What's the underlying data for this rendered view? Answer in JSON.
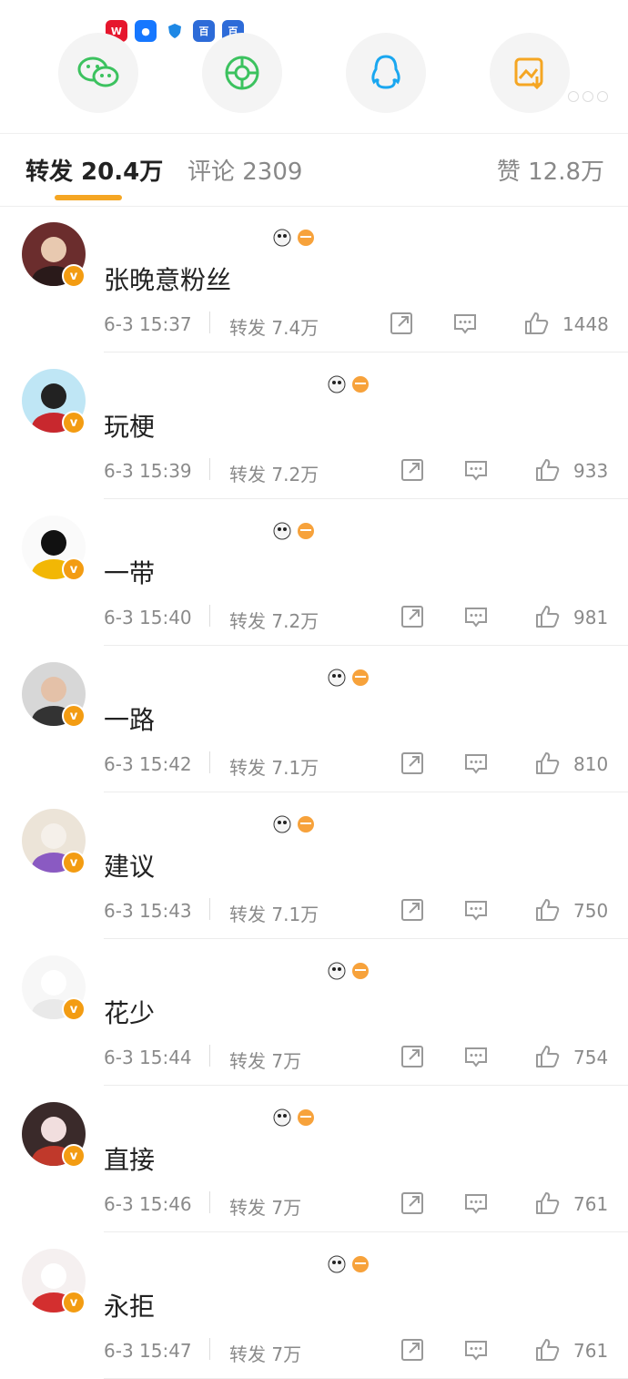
{
  "share_targets": [
    {
      "name": "wechat"
    },
    {
      "name": "moments"
    },
    {
      "name": "qq"
    },
    {
      "name": "save-image"
    }
  ],
  "tabs": {
    "repost_label": "转发 20.4万",
    "comment_label": "评论 2309",
    "like_label": "赞 12.8万"
  },
  "items": [
    {
      "username": "张晚意粉丝",
      "time": "6-3 15:37",
      "reposts": "转发 7.4万",
      "likes": "1448"
    },
    {
      "username": "玩梗",
      "time": "6-3 15:39",
      "reposts": "转发 7.2万",
      "likes": "933"
    },
    {
      "username": "一带",
      "time": "6-3 15:40",
      "reposts": "转发 7.2万",
      "likes": "981"
    },
    {
      "username": "一路",
      "time": "6-3 15:42",
      "reposts": "转发 7.1万",
      "likes": "810"
    },
    {
      "username": "建议",
      "time": "6-3 15:43",
      "reposts": "转发 7.1万",
      "likes": "750"
    },
    {
      "username": "花少",
      "time": "6-3 15:44",
      "reposts": "转发 7万",
      "likes": "754"
    },
    {
      "username": "直接",
      "time": "6-3 15:46",
      "reposts": "转发 7万",
      "likes": "761"
    },
    {
      "username": "永拒",
      "time": "6-3 15:47",
      "reposts": "转发 7万",
      "likes": "761"
    }
  ],
  "colors": {
    "accent": "#f5a623",
    "verified": "#f39c12",
    "text_secondary": "#8a8a8a"
  }
}
